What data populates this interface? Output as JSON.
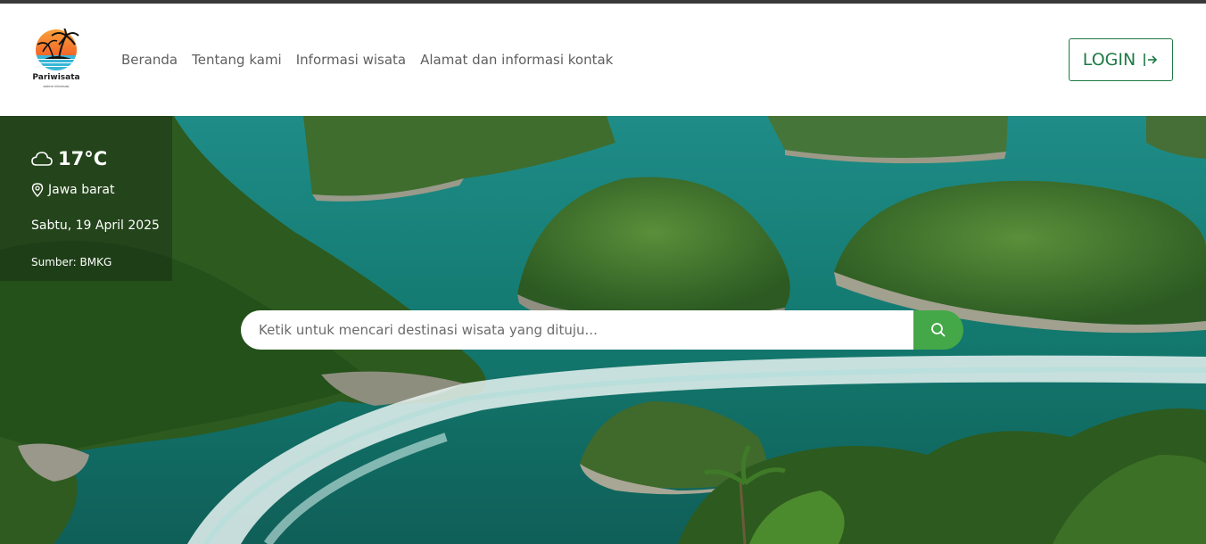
{
  "brand": {
    "name": "Pariwisata",
    "tagline": "sistem informasi"
  },
  "nav": [
    {
      "label": "Beranda"
    },
    {
      "label": "Tentang kami"
    },
    {
      "label": "Informasi wisata"
    },
    {
      "label": "Alamat dan informasi kontak"
    }
  ],
  "login": {
    "label": "LOGIN",
    "icon": "login-arrow-icon"
  },
  "weather": {
    "icon": "cloud-icon",
    "temperature": "17°C",
    "location_icon": "map-pin-icon",
    "location": "Jawa barat",
    "date": "Sabtu, 19 April 2025",
    "source": "Sumber: BMKG"
  },
  "search": {
    "placeholder": "Ketik untuk mencari destinasi wisata yang dituju...",
    "value": "",
    "icon": "search-icon"
  },
  "hero": {
    "image": "tropical-islands-aerial-photo"
  },
  "colors": {
    "accent_green": "#45a848",
    "login_green": "#1e7a46",
    "nav_text": "#5f5f5f",
    "topline": "#3a3a3a"
  }
}
